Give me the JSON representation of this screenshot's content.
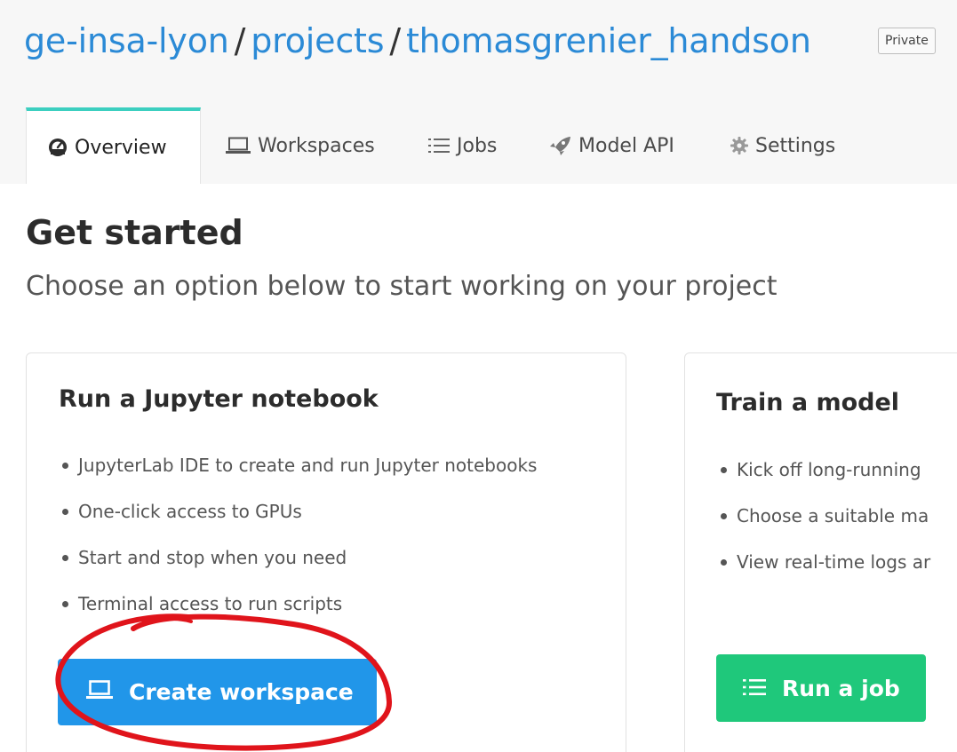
{
  "breadcrumb": {
    "org": "ge-insa-lyon",
    "sep1": "/",
    "section": "projects",
    "sep2": "/",
    "project": "thomasgrenier_handson",
    "badge": "Private"
  },
  "tabs": [
    {
      "label": "Overview",
      "icon": "dashboard-icon",
      "active": true
    },
    {
      "label": "Workspaces",
      "icon": "laptop-icon",
      "active": false
    },
    {
      "label": "Jobs",
      "icon": "list-icon",
      "active": false
    },
    {
      "label": "Model API",
      "icon": "rocket-icon",
      "active": false
    },
    {
      "label": "Settings",
      "icon": "gear-icon",
      "active": false
    }
  ],
  "main": {
    "title": "Get started",
    "subtitle": "Choose an option below to start working on your project"
  },
  "cards": [
    {
      "title": "Run a Jupyter notebook",
      "items": [
        "JupyterLab IDE to create and run Jupyter notebooks",
        "One-click access to GPUs",
        "Start and stop when you need",
        "Terminal access to run scripts"
      ],
      "button": {
        "label": "Create workspace",
        "icon": "laptop-icon",
        "color": "#2196e9"
      }
    },
    {
      "title": "Train a model",
      "items": [
        "Kick off long-running",
        "Choose a suitable ma",
        "View real-time logs ar"
      ],
      "button": {
        "label": "Run a job",
        "icon": "list-icon",
        "color": "#1fc87b"
      }
    }
  ],
  "colors": {
    "accent_tab": "#3ccfc0",
    "link": "#2b8ad6",
    "annotation": "#e0141b"
  }
}
